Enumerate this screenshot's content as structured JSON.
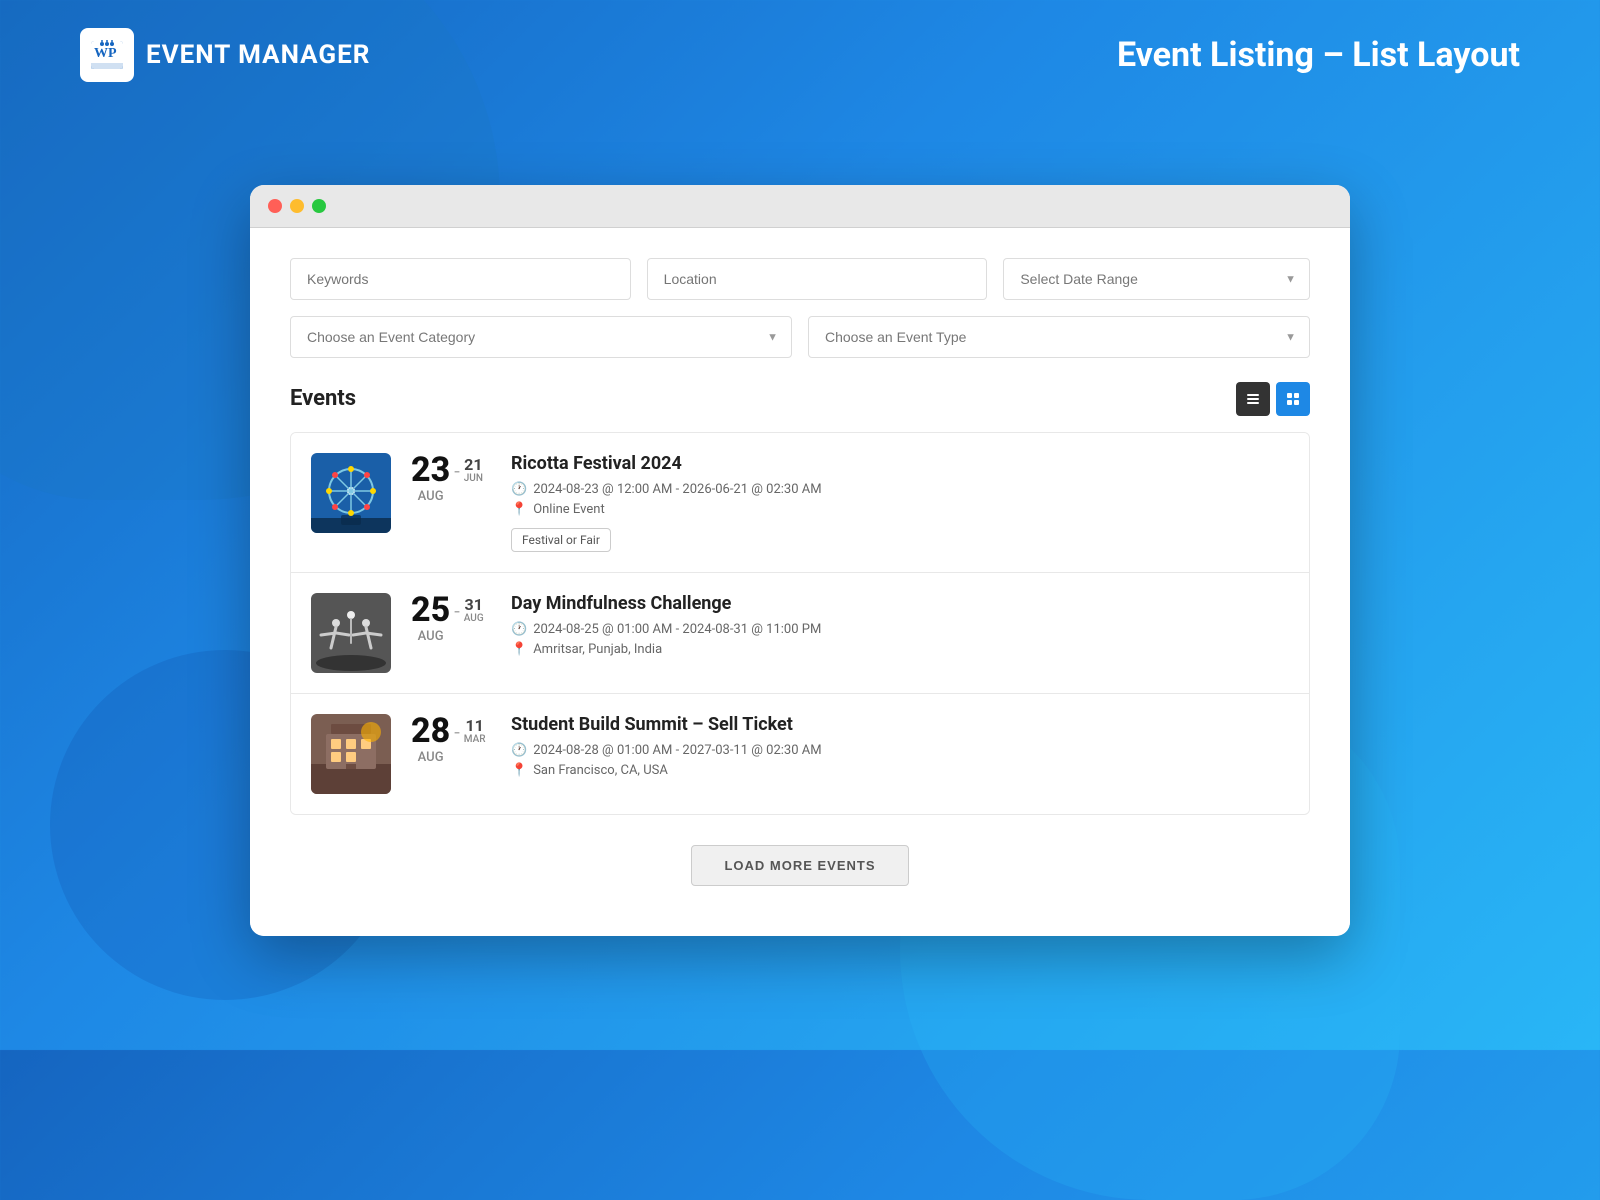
{
  "header": {
    "logo_text": "EVENT MANAGER",
    "logo_wp": "WP",
    "page_title": "Event Listing – List Layout"
  },
  "filters": {
    "keywords_placeholder": "Keywords",
    "location_placeholder": "Location",
    "date_range_placeholder": "Select Date Range",
    "category_placeholder": "Choose an Event Category",
    "type_placeholder": "Choose an Event Type"
  },
  "events_section": {
    "title": "Events",
    "list_view_label": "List View",
    "grid_view_label": "Grid View"
  },
  "events": [
    {
      "id": 1,
      "start_day": "23",
      "start_month": "AUG",
      "end_day": "21",
      "end_month": "JUN",
      "name": "Ricotta Festival 2024",
      "datetime": "2024-08-23 @ 12:00 AM - 2026-06-21 @ 02:30 AM",
      "location": "Online Event",
      "tag": "Festival or Fair",
      "img_type": "ferris"
    },
    {
      "id": 2,
      "start_day": "25",
      "start_month": "AUG",
      "end_day": "31",
      "end_month": "AUG",
      "name": "Day Mindfulness Challenge",
      "datetime": "2024-08-25 @ 01:00 AM - 2024-08-31 @ 11:00 PM",
      "location": "Amritsar, Punjab, India",
      "tag": "",
      "img_type": "yoga"
    },
    {
      "id": 3,
      "start_day": "28",
      "start_month": "AUG",
      "end_day": "11",
      "end_month": "MAR",
      "name": "Student Build Summit – Sell Ticket",
      "datetime": "2024-08-28 @ 01:00 AM - 2027-03-11 @ 02:30 AM",
      "location": "San Francisco, CA, USA",
      "tag": "",
      "img_type": "summit"
    }
  ],
  "load_more": {
    "label": "LOAD MORE EVENTS"
  },
  "dots": {
    "red": "●",
    "yellow": "●",
    "green": "●"
  }
}
